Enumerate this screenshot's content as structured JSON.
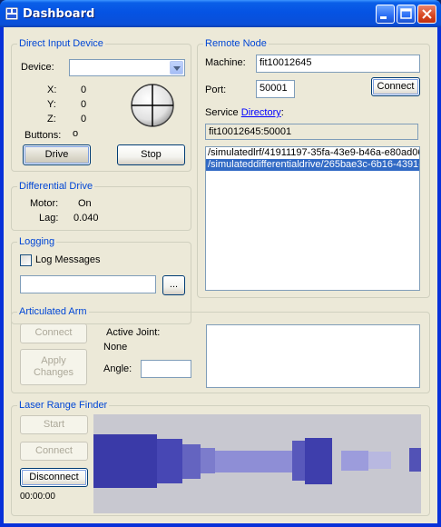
{
  "window": {
    "title": "Dashboard"
  },
  "direct_input": {
    "legend": "Direct Input Device",
    "device_label": "Device:",
    "device_value": "",
    "x_label": "X:",
    "x_value": "0",
    "y_label": "Y:",
    "y_value": "0",
    "z_label": "Z:",
    "z_value": "0",
    "buttons_label": "Buttons:",
    "buttons_value": "o",
    "drive_label": "Drive",
    "stop_label": "Stop"
  },
  "differential_drive": {
    "legend": "Differential Drive",
    "motor_label": "Motor:",
    "motor_value": "On",
    "lag_label": "Lag:",
    "lag_value": "0.040"
  },
  "logging": {
    "legend": "Logging",
    "log_messages_label": "Log Messages",
    "log_messages_checked": false,
    "file_value": "",
    "browse_label": "..."
  },
  "remote_node": {
    "legend": "Remote Node",
    "machine_label": "Machine:",
    "machine_value": "fit10012645",
    "port_label": "Port:",
    "port_value": "50001",
    "connect_label": "Connect",
    "service_label": "Service",
    "directory_link": "Directory",
    "colon": ":",
    "service_value": "fit10012645:50001",
    "services": [
      {
        "text": "/simulatedlrf/41911197-35fa-43e9-b46a-e80ad06",
        "selected": false
      },
      {
        "text": "/simulateddifferentialdrive/265bae3c-6b16-4391-",
        "selected": true
      }
    ]
  },
  "articulated_arm": {
    "legend": "Articulated Arm",
    "connect_label": "Connect",
    "apply_label": "Apply Changes",
    "active_joint_label": "Active Joint:",
    "active_joint_value": "None",
    "angle_label": "Angle:",
    "angle_value": ""
  },
  "laser_range_finder": {
    "legend": "Laser Range Finder",
    "start_label": "Start",
    "connect_label": "Connect",
    "disconnect_label": "Disconnect",
    "time_value": "00:00:00"
  },
  "colors": {
    "accent": "#0046d5",
    "laser_near": "#3a3aa8",
    "laser_far": "#b8b8e0",
    "laser_background": "#c8c8d0"
  }
}
